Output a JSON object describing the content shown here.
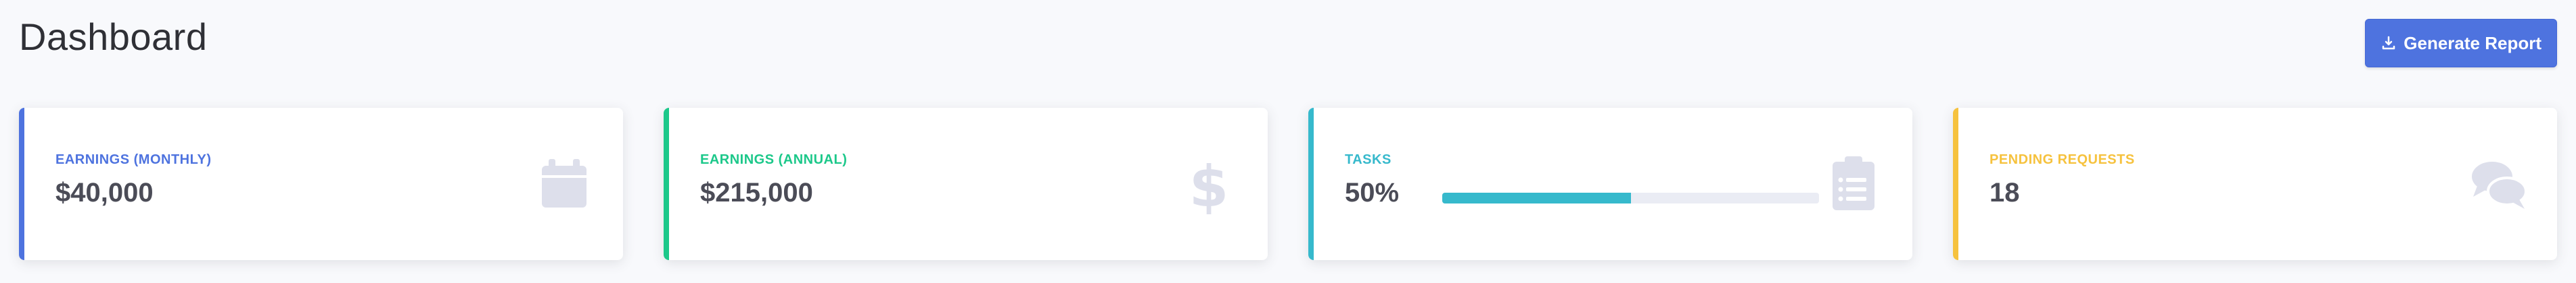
{
  "header": {
    "title": "Dashboard",
    "report_button_label": "Generate Report"
  },
  "cards": [
    {
      "label": "Earnings (Monthly)",
      "value": "$40,000",
      "accent": "#4e73df",
      "label_color": "#4e73df",
      "icon": "calendar-icon"
    },
    {
      "label": "Earnings (Annual)",
      "value": "$215,000",
      "accent": "#1cc88a",
      "label_color": "#1cc88a",
      "icon": "dollar-icon"
    },
    {
      "label": "Tasks",
      "value": "50%",
      "progress": 0.5,
      "accent": "#36b9cc",
      "label_color": "#36b9cc",
      "icon": "clipboard-list-icon"
    },
    {
      "label": "Pending Requests",
      "value": "18",
      "accent": "#f6c23e",
      "label_color": "#f6c23e",
      "icon": "comments-icon"
    }
  ],
  "colors": {
    "primary": "#4e73df",
    "icon_muted": "#dddfeb",
    "background": "#f8f9fc"
  }
}
